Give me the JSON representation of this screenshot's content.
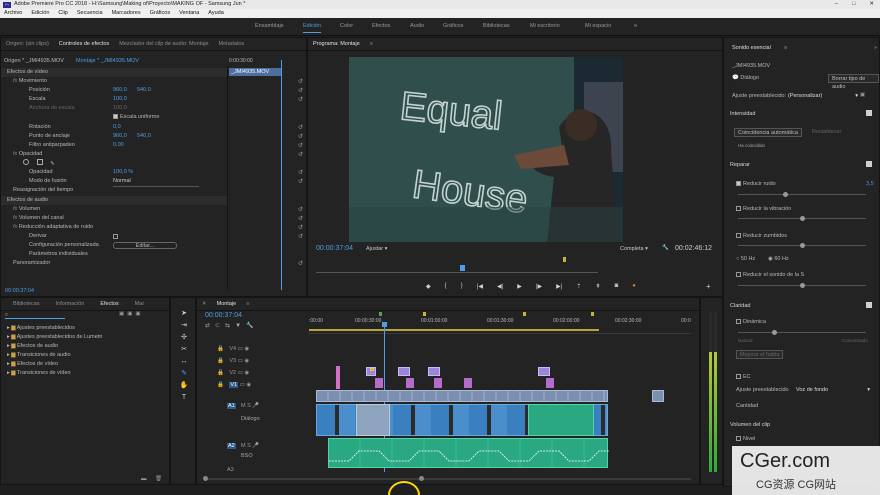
{
  "title": "Adobe Premiere Pro CC 2018 - H:\\Samsung\\Making of\\Proyecto\\MAKING OF - Samsung Jun *",
  "menu": [
    "Archivo",
    "Edición",
    "Clip",
    "Secuencia",
    "Marcadores",
    "Gráficos",
    "Ventana",
    "Ayuda"
  ],
  "workspaces": [
    "Ensamblaje",
    "Edición",
    "Color",
    "Efectos",
    "Audio",
    "Gráficos",
    "Bibliotecas",
    "Mi escritorio",
    "Mi espacio"
  ],
  "active_workspace": "Edición",
  "source_panel": {
    "tabs": [
      "Origen: (sin clips)",
      "Controles de efectos",
      "Mezclador del clip de audio: Montaje",
      "Metadatos"
    ],
    "clip_path": "Origen * _JMI4935.MOV",
    "clip_name": "Montaje * _JMI4935.MOV",
    "mini_time": "0:00:30:00",
    "mini_clip": "_JMI4935.MOV",
    "video_effects": "Efectos de vídeo",
    "rows": {
      "motion": "Movimiento",
      "position": "Posición",
      "pos_x": "960,0",
      "pos_y": "540,0",
      "scale": "Escala",
      "scale_v": "100,0",
      "scale_w": "Anchura de escala",
      "uniform": "Escala uniforme",
      "rotation": "Rotación",
      "rotation_v": "0,0",
      "anchor": "Punto de anclaje",
      "anchor_x": "960,0",
      "anchor_y": "540,0",
      "flicker": "Filtro antiparpadeo",
      "flicker_v": "0,00",
      "opacity": "Opacidad",
      "opacity_sub": "Opacidad",
      "opacity_v": "100,0 %",
      "blend": "Modo de fusión",
      "blend_v": "Normal",
      "remap": "Reasignación del tiempo",
      "audio_effects": "Efectos de audio",
      "volume": "Volumen",
      "channel_volume": "Volumen del canal",
      "denoise": "Reducción adaptativa de ruido",
      "bypass": "Derivar",
      "custom_config": "Configuración personalizada",
      "edit_btn": "Editar...",
      "params": "Parámetros individuales",
      "panner": "Panoramizador"
    },
    "footer_time": "00:00:37:04"
  },
  "program": {
    "tab": "Programa: Montaje",
    "timecode": "00:00:37:04",
    "fit": "Ajustar",
    "quality": "Completa",
    "duration": "00:02:46:12",
    "chalk_line1": "Equal",
    "chalk_line2": "House"
  },
  "project": {
    "tabs": [
      "Bibliotecas",
      "Información",
      "Efectos",
      "Mar"
    ],
    "items": [
      "Ajustes preestablecidos",
      "Ajustes preestablecidos de Lumetri",
      "Efectos de audio",
      "Transiciones de audio",
      "Efectos de vídeo",
      "Transiciones de vídeo"
    ]
  },
  "timeline": {
    "tab": "Montaje",
    "timecode": "00:00:37:04",
    "ruler": [
      ":00:00",
      "00:00:30:00",
      "00:01:00:00",
      "00:01:30:00",
      "00:02:00:00",
      "00:02:30:00",
      "00:0"
    ],
    "tracks_video": [
      "V4",
      "V3",
      "V2",
      "V1"
    ],
    "tracks_audio": [
      "A1",
      "A2",
      "A3"
    ],
    "a1_name": "Diálogo",
    "a2_name": "BSO"
  },
  "essential_sound": {
    "title": "Sonido esencial",
    "clip": "_JMI4935.MOV",
    "type": "Diálogo",
    "clear_type": "Borrar tipo de audio",
    "preset_label": "Ajuste preestablecido:",
    "preset_value": "(Personalizar)",
    "loudness": "Intensidad",
    "auto_match": "Coincidencia automática",
    "restore": "Restablecer",
    "matched": "Ha coincidido",
    "repair": "Reparar",
    "reduce_noise": "Reducir ruido",
    "reduce_noise_v": "3,5",
    "reduce_rumble": "Reducir la vibración",
    "dehum": "Reducir zumbidos",
    "hz50": "50 Hz",
    "hz60": "60 Hz",
    "reduce_s": "Reducir el sonido de la S",
    "clarity": "Claridad",
    "dynamics": "Dinámica",
    "natural": "Natural",
    "focused": "Concentrado",
    "enhance": "Mejorar el habla",
    "eq": "EC",
    "eq_preset_label": "Ajuste preestablecido",
    "eq_preset": "Voz de fondo",
    "amount": "Cantidad",
    "clip_volume": "Volumen del clip",
    "level": "Nivel"
  },
  "watermark": {
    "main": "CGer.com",
    "sub": "CG资源 CG网站"
  },
  "colors": {
    "accent": "#4d9eea",
    "bg": "#232323",
    "audio_green": "#2aa882",
    "video_blue": "#7b8fb0",
    "violet": "#9c86d8"
  }
}
